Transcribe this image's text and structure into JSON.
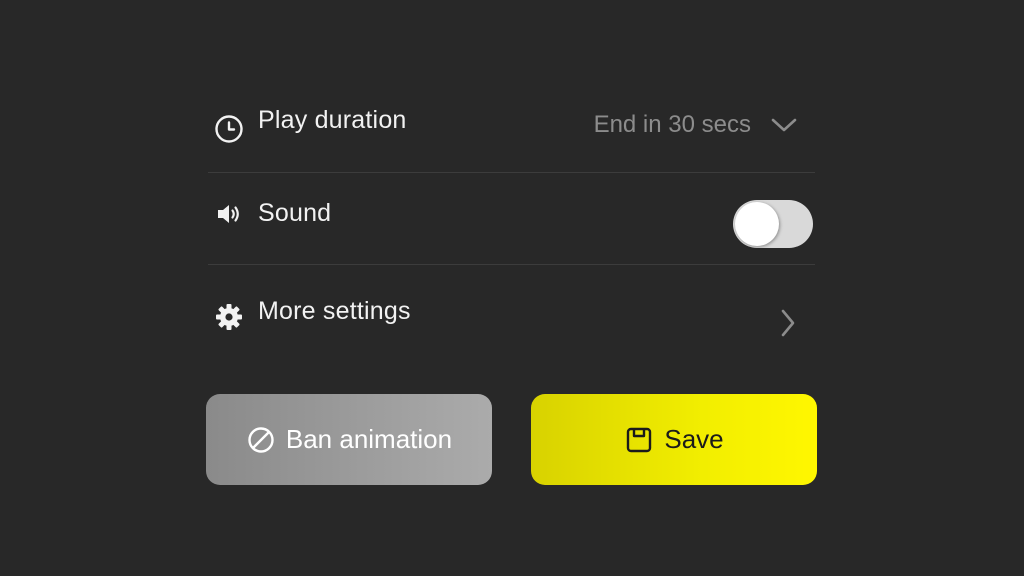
{
  "settings": {
    "play_duration": {
      "label": "Play duration",
      "icon": "clock-icon",
      "value": "End in 30 secs"
    },
    "sound": {
      "label": "Sound",
      "icon": "speaker-icon",
      "enabled": false
    },
    "more_settings": {
      "label": "More settings",
      "icon": "gear-icon"
    }
  },
  "buttons": {
    "ban_label": "Ban animation",
    "ban_icon": "block-icon",
    "save_label": "Save",
    "save_icon": "save-icon"
  },
  "colors": {
    "background": "#282828",
    "save_accent": "#f2ee00",
    "ban_button": "#9b9b9b"
  }
}
